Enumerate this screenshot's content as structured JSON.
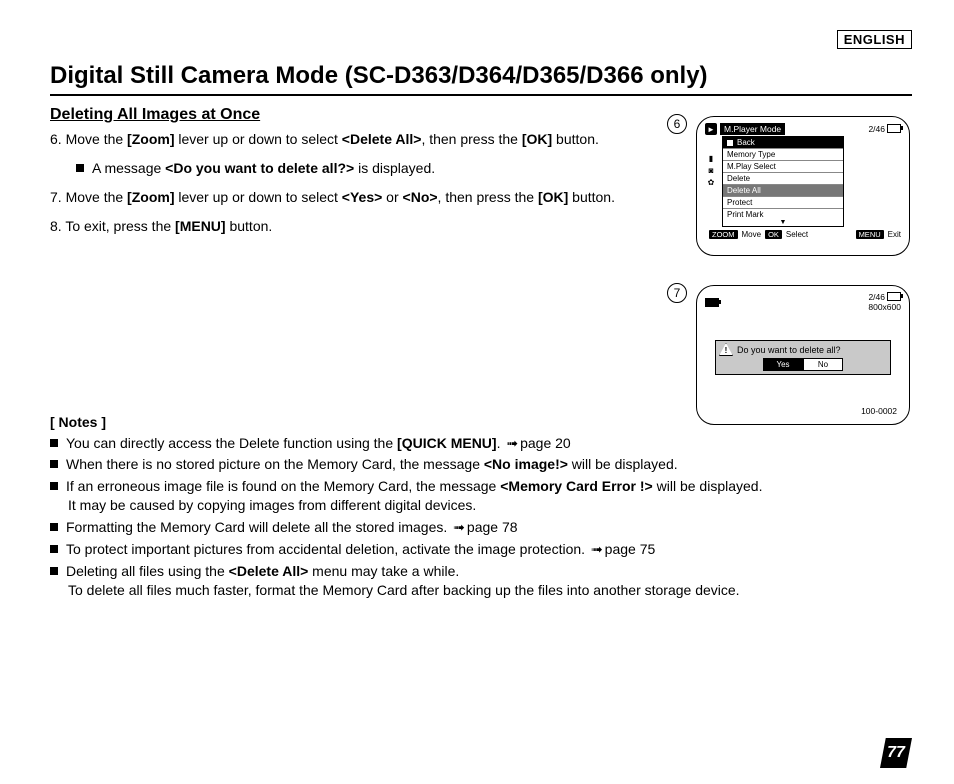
{
  "language": "ENGLISH",
  "title": "Digital Still Camera Mode (SC-D363/D364/D365/D366 only)",
  "section": "Deleting All Images at Once",
  "steps": {
    "s6a": "6. Move the ",
    "s6_zoom": "[Zoom]",
    "s6b": " lever up or down to select ",
    "s6_da": "<Delete All>",
    "s6c": ", then press the ",
    "s6_ok": "[OK]",
    "s6d": " button.",
    "s6_msg_pre": "A message ",
    "s6_msg": "<Do you want to delete all?>",
    "s6_msg_post": " is displayed.",
    "s7a": "7. Move the ",
    "s7_zoom": "[Zoom]",
    "s7b": " lever up or down to select ",
    "s7_yes": "<Yes>",
    "s7_or": " or ",
    "s7_no": "<No>",
    "s7c": ", then press the ",
    "s7_ok": "[OK]",
    "s7d": " button.",
    "s8a": "8. To exit, press the ",
    "s8_menu": "[MENU]",
    "s8b": " button."
  },
  "notes_header": "[ Notes ]",
  "notes": {
    "n1a": "You can directly access the Delete function using the ",
    "n1b": "[QUICK MENU]",
    "n1c": ". ",
    "n1_page": "page 20",
    "n2a": "When there is no stored picture on the Memory Card, the message ",
    "n2b": "<No image!>",
    "n2c": " will be displayed.",
    "n3a": "If an erroneous image file is found on the Memory Card, the message ",
    "n3b": "<Memory Card Error !>",
    "n3c": " will be displayed.",
    "n3d": "It may be caused by copying images from different digital devices.",
    "n4a": "Formatting the Memory Card will delete all the stored images. ",
    "n4_page": "page 78",
    "n5a": "To protect important pictures from accidental deletion, activate the image protection. ",
    "n5_page": "page 75",
    "n6a": "Deleting all files using the ",
    "n6b": "<Delete All>",
    "n6c": " menu may take a while.",
    "n6d": "To delete all files much faster, format the Memory Card after backing up the files into another storage device."
  },
  "cam6": {
    "badge": "6",
    "mode": "M.Player Mode",
    "counter": "2/46",
    "menu": [
      "Back",
      "Memory Type",
      "M.Play Select",
      "Delete",
      "Delete All",
      "Protect",
      "Print Mark"
    ],
    "zoom_chip": "ZOOM",
    "zoom_lbl": "Move",
    "ok_chip": "OK",
    "ok_lbl": "Select",
    "menu_chip": "MENU",
    "menu_lbl": "Exit"
  },
  "cam7": {
    "badge": "7",
    "counter": "2/46",
    "res": "800x600",
    "dialog": "Do you want to delete all?",
    "yes": "Yes",
    "no": "No",
    "file": "100-0002"
  },
  "page_number": "77"
}
